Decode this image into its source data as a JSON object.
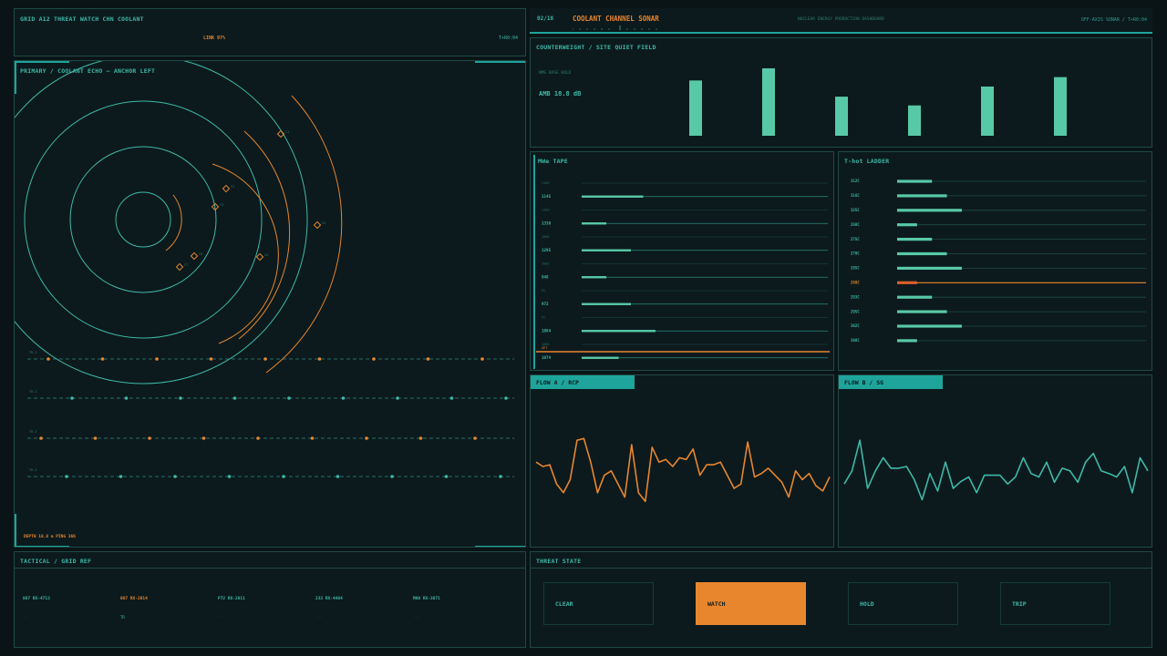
{
  "header_left": {
    "title": "GRID A12  THREAT WATCH  CHN COOLANT",
    "link": "LINK 97%",
    "clock": "T+R0:04"
  },
  "header_right": {
    "page": "02/18",
    "title": "COOLANT CHANNEL SONAR",
    "subtitle": "NUCLEAR ENERGY PRODUCTION DASHBOARD",
    "mode": "OFF-AXIS SONAR / T+R0:04"
  },
  "sonar": {
    "title": "PRIMARY / COOLANT ECHO — ANCHOR LEFT",
    "footer": "DEPTH 18.8 m  PING 366",
    "contacts": [
      {
        "label": "C1"
      },
      {
        "label": "C2"
      },
      {
        "label": "C3"
      },
      {
        "label": "C4"
      },
      {
        "label": "C5"
      },
      {
        "label": "C6"
      },
      {
        "label": "C7"
      }
    ],
    "tracks": [
      {
        "label": "TR-1",
        "color": "#e8862e"
      },
      {
        "label": "TR-2",
        "color": "#3fb8a8"
      },
      {
        "label": "TR-3",
        "color": "#e8862e"
      },
      {
        "label": "TR-4",
        "color": "#3fb8a8"
      }
    ]
  },
  "counterweight": {
    "title": "COUNTERWEIGHT / SITE QUIET FIELD",
    "note": "NMS BASE HOLD",
    "ambient": "AMB 18.8 dB",
    "bar_color": "#58c9a6",
    "bars": [
      0.82,
      1.0,
      0.58,
      0.45,
      0.73,
      0.87
    ]
  },
  "mwe_tape": {
    "title": "MWe TAPE",
    "rows": [
      {
        "label": "1160",
        "value": null
      },
      {
        "label": "1145",
        "value": 0.25
      },
      {
        "label": "1300",
        "value": null
      },
      {
        "label": "1338",
        "value": 0.1
      },
      {
        "label": "1000",
        "value": null
      },
      {
        "label": "1295",
        "value": 0.2
      },
      {
        "label": "1085",
        "value": null
      },
      {
        "label": "948",
        "value": 0.1
      },
      {
        "label": "0%",
        "value": null
      },
      {
        "label": "972",
        "value": 0.2
      },
      {
        "label": "5%",
        "value": null
      },
      {
        "label": "1084",
        "value": 0.3
      },
      {
        "label": "1800",
        "value": null
      },
      {
        "label": "1074",
        "value": 0.15
      }
    ],
    "marker_label": "SET"
  },
  "thot_ladder": {
    "title": "T-hot LADDER",
    "rows": [
      {
        "label": "312C",
        "value": 0.14,
        "hi": false
      },
      {
        "label": "316C",
        "value": 0.2,
        "hi": false
      },
      {
        "label": "325C",
        "value": 0.26,
        "hi": false
      },
      {
        "label": "268C",
        "value": 0.08,
        "hi": false
      },
      {
        "label": "275C",
        "value": 0.14,
        "hi": false
      },
      {
        "label": "270C",
        "value": 0.2,
        "hi": false
      },
      {
        "label": "285C",
        "value": 0.26,
        "hi": false
      },
      {
        "label": "288C",
        "value": 0.08,
        "hi": true
      },
      {
        "label": "293C",
        "value": 0.14,
        "hi": false
      },
      {
        "label": "295C",
        "value": 0.2,
        "hi": false
      },
      {
        "label": "302C",
        "value": 0.26,
        "hi": false
      },
      {
        "label": "308C",
        "value": 0.08,
        "hi": false
      }
    ]
  },
  "flow_a": {
    "title": "FLOW A / RCP",
    "color": "#e8862e",
    "values": [
      0.55,
      0.5,
      0.52,
      0.3,
      0.2,
      0.35,
      0.8,
      0.82,
      0.55,
      0.2,
      0.4,
      0.45,
      0.3,
      0.15,
      0.75,
      0.2,
      0.1,
      0.72,
      0.55,
      0.58,
      0.5,
      0.6,
      0.58,
      0.7,
      0.4,
      0.52,
      0.52,
      0.55,
      0.4,
      0.25,
      0.3,
      0.78,
      0.38,
      0.42,
      0.48,
      0.4,
      0.32,
      0.15,
      0.45,
      0.35,
      0.42,
      0.28,
      0.22,
      0.38
    ]
  },
  "flow_b": {
    "title": "FLOW B / SG",
    "color": "#3fb8a8",
    "values": [
      0.3,
      0.45,
      0.8,
      0.25,
      0.45,
      0.6,
      0.48,
      0.48,
      0.5,
      0.35,
      0.12,
      0.42,
      0.22,
      0.55,
      0.25,
      0.33,
      0.38,
      0.2,
      0.4,
      0.4,
      0.4,
      0.3,
      0.38,
      0.6,
      0.42,
      0.38,
      0.55,
      0.32,
      0.48,
      0.45,
      0.32,
      0.55,
      0.65,
      0.45,
      0.42,
      0.38,
      0.5,
      0.2,
      0.6,
      0.45
    ]
  },
  "tactical": {
    "title": "TACTICAL / GRID REF",
    "cells": [
      {
        "code": "867 RX-4713",
        "sub": "---",
        "hi": false
      },
      {
        "code": "067 RX-2814",
        "sub": "TR",
        "hi": true
      },
      {
        "code": "P72 RX-2811",
        "sub": "---",
        "hi": false
      },
      {
        "code": "233 RX-4484",
        "sub": "---",
        "hi": false
      },
      {
        "code": "M80 RX-3871",
        "sub": "---",
        "hi": false
      }
    ]
  },
  "threat": {
    "title": "THREAT STATE",
    "buttons": [
      {
        "label": "CLEAR",
        "active": false
      },
      {
        "label": "WATCH",
        "active": true
      },
      {
        "label": "HOLD",
        "active": false
      },
      {
        "label": "TRIP",
        "active": false
      }
    ]
  },
  "colors": {
    "accent": "#3fb8a8",
    "warn": "#e8862e",
    "bg": "#0a1417",
    "panel": "#0c1a1d"
  }
}
